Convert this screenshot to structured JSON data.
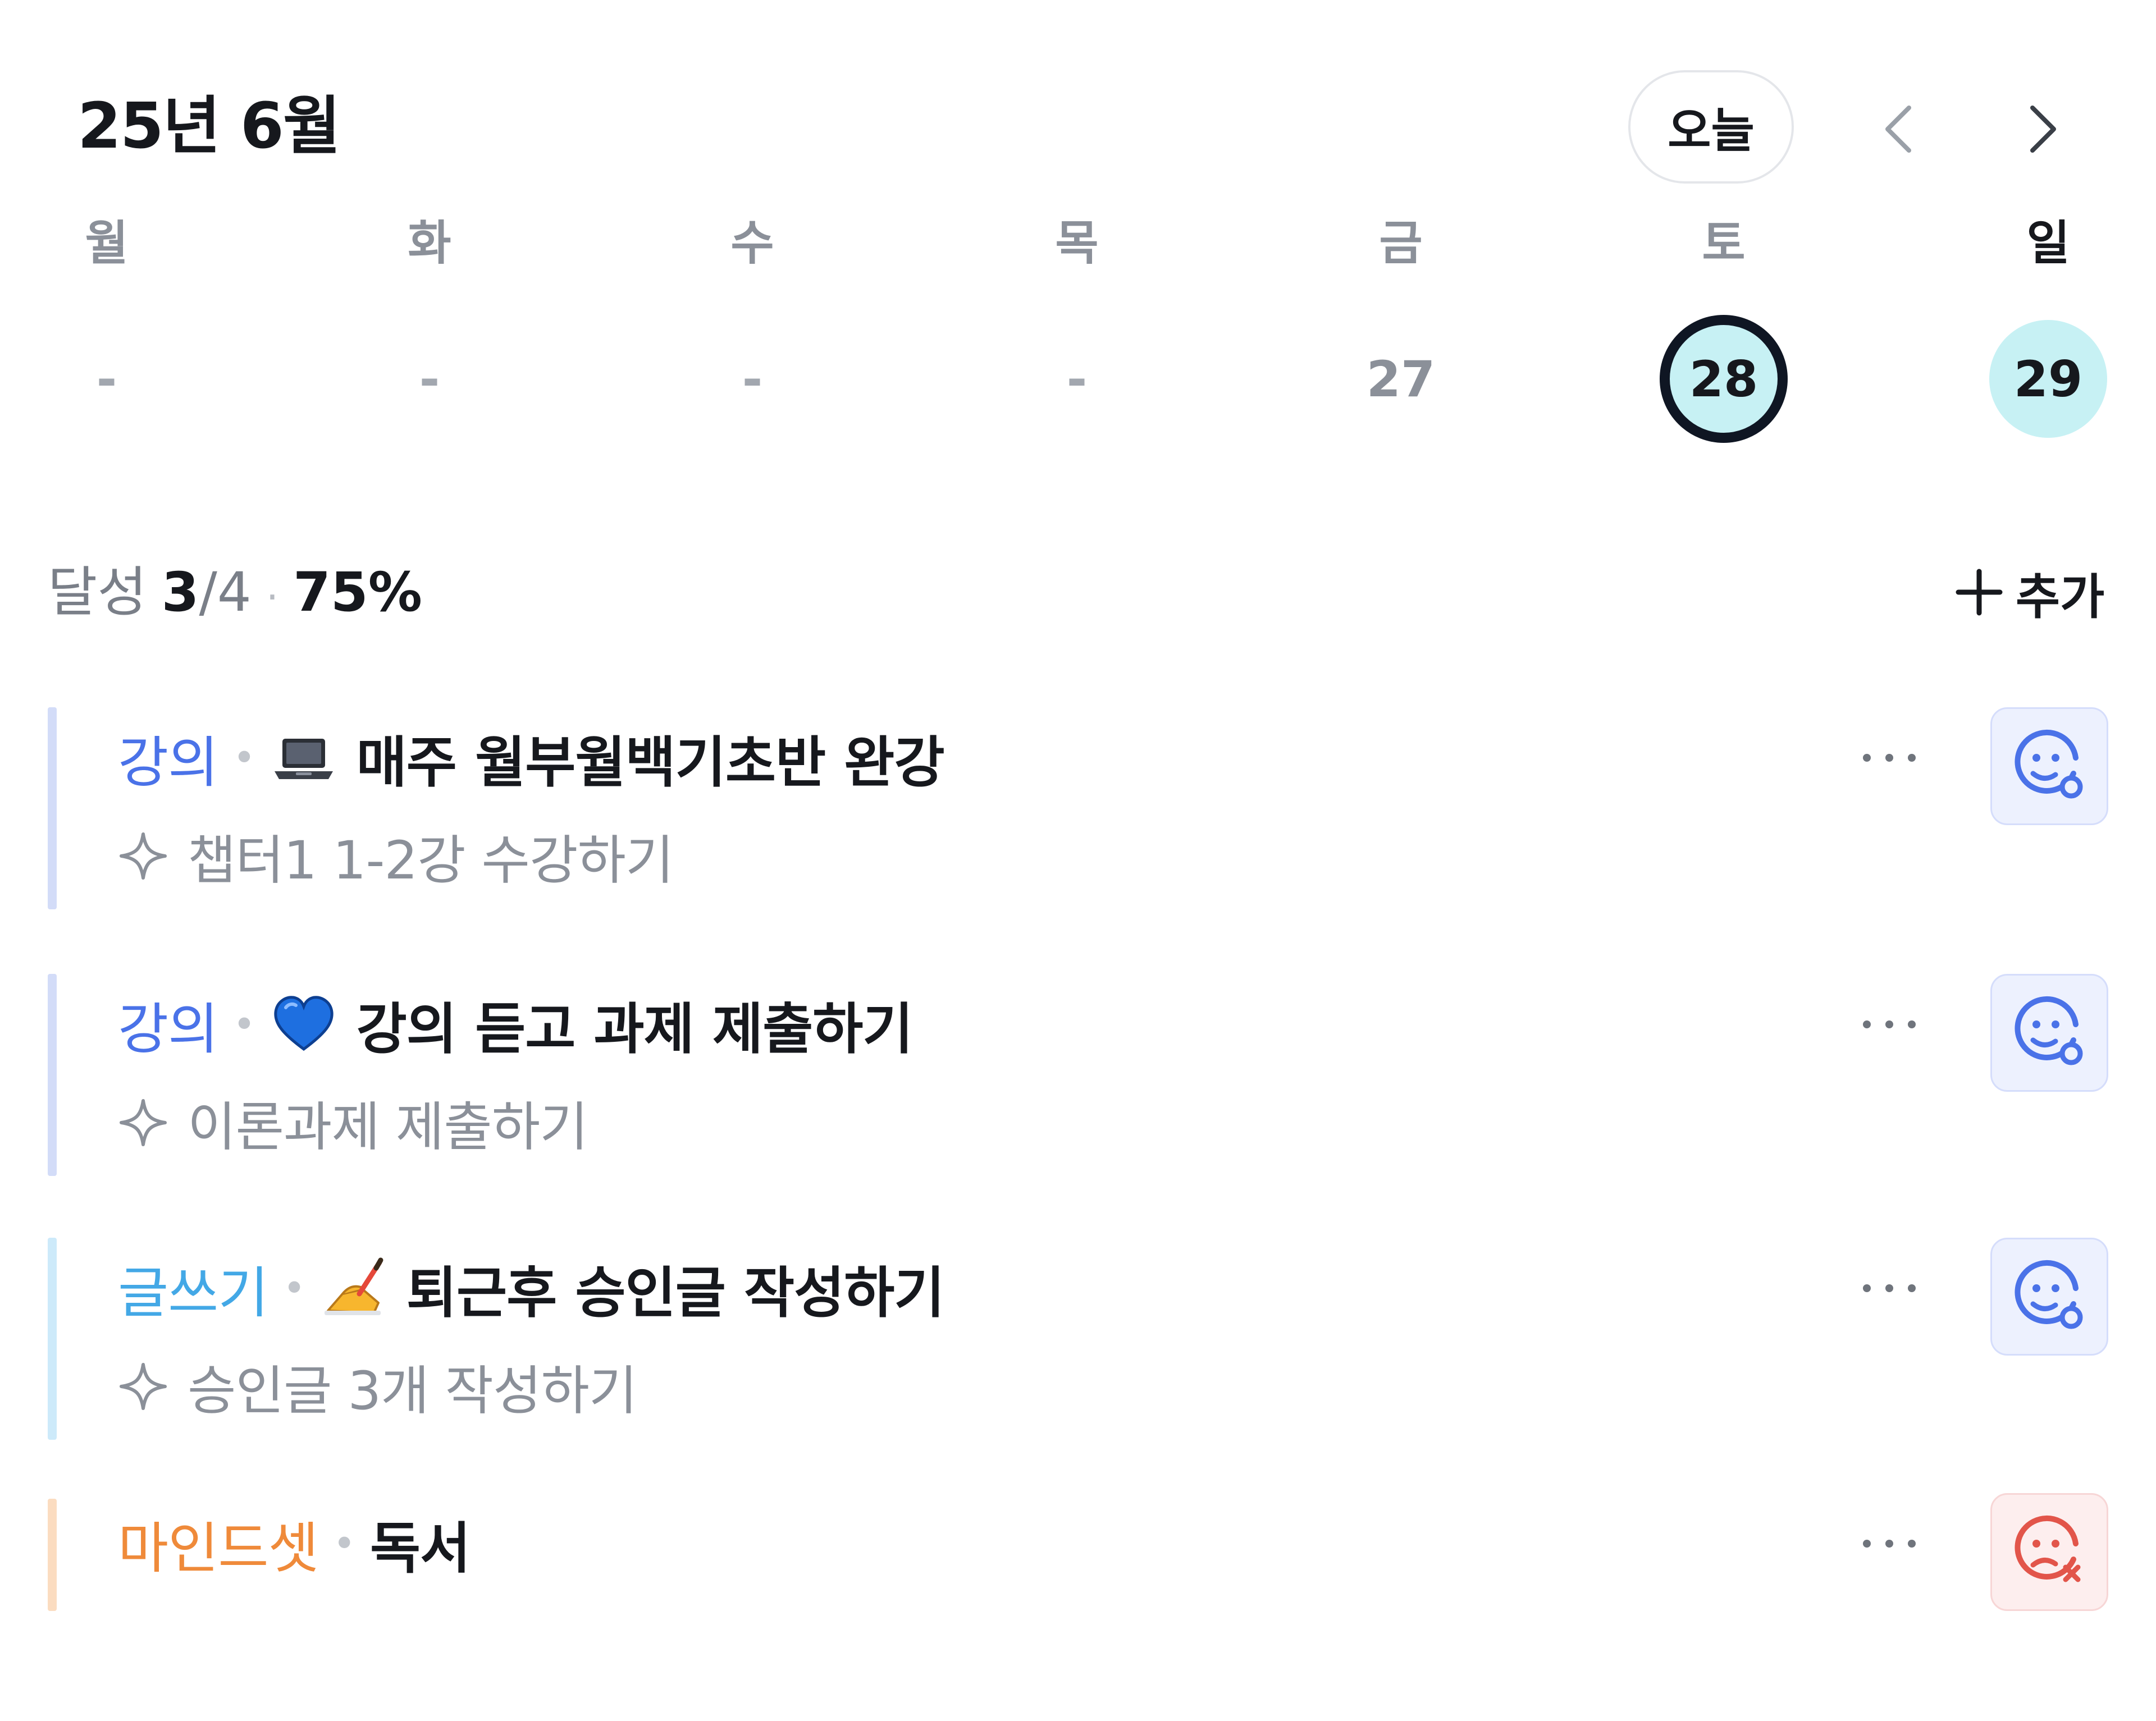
{
  "header": {
    "month_title": "25년 6월",
    "today_label": "오늘",
    "prev_icon": "chevron-left-icon",
    "next_icon": "chevron-right-icon"
  },
  "week": {
    "days": [
      {
        "weekday": "월",
        "date": "-"
      },
      {
        "weekday": "화",
        "date": "-"
      },
      {
        "weekday": "수",
        "date": "-"
      },
      {
        "weekday": "목",
        "date": "-"
      },
      {
        "weekday": "금",
        "date": "27"
      },
      {
        "weekday": "토",
        "date": "28",
        "selected": true
      },
      {
        "weekday": "일",
        "date": "29",
        "highlighted": true
      }
    ]
  },
  "summary": {
    "label": "달성",
    "done": "3",
    "total": "/4",
    "separator": "·",
    "percent": "75%",
    "add_label": "추가"
  },
  "goals": [
    {
      "category": "강의",
      "category_color": "#4a72e8",
      "bar_color": "#d3dcf8",
      "emoji": "laptop",
      "name": "매주 월부월백기초반 완강",
      "subtask": "챕터1 1-2강 수강하기",
      "status": "face-check-icon"
    },
    {
      "category": "강의",
      "category_color": "#4a72e8",
      "bar_color": "#d3dcf8",
      "emoji": "blue-heart",
      "name": "강의 듣고 과제 제출하기",
      "subtask": "이론과제 제출하기",
      "status": "face-check-icon"
    },
    {
      "category": "글쓰기",
      "category_color": "#43a8e6",
      "bar_color": "#cdeafa",
      "emoji": "writing-hand",
      "name": "퇴근후 승인글 작성하기",
      "subtask": "승인글 3개 작성하기",
      "status": "face-check-icon"
    },
    {
      "category": "마인드셋",
      "category_color": "#ef8a3a",
      "bar_color": "#fbdcc0",
      "emoji": "",
      "name": "독서",
      "subtask": "",
      "status": "face-x-icon"
    }
  ],
  "colors": {
    "accent_blue": "#4a72e8",
    "selected_ring": "#0f1623",
    "date_fill": "#c7f1f4",
    "fail_red": "#e2554a"
  }
}
